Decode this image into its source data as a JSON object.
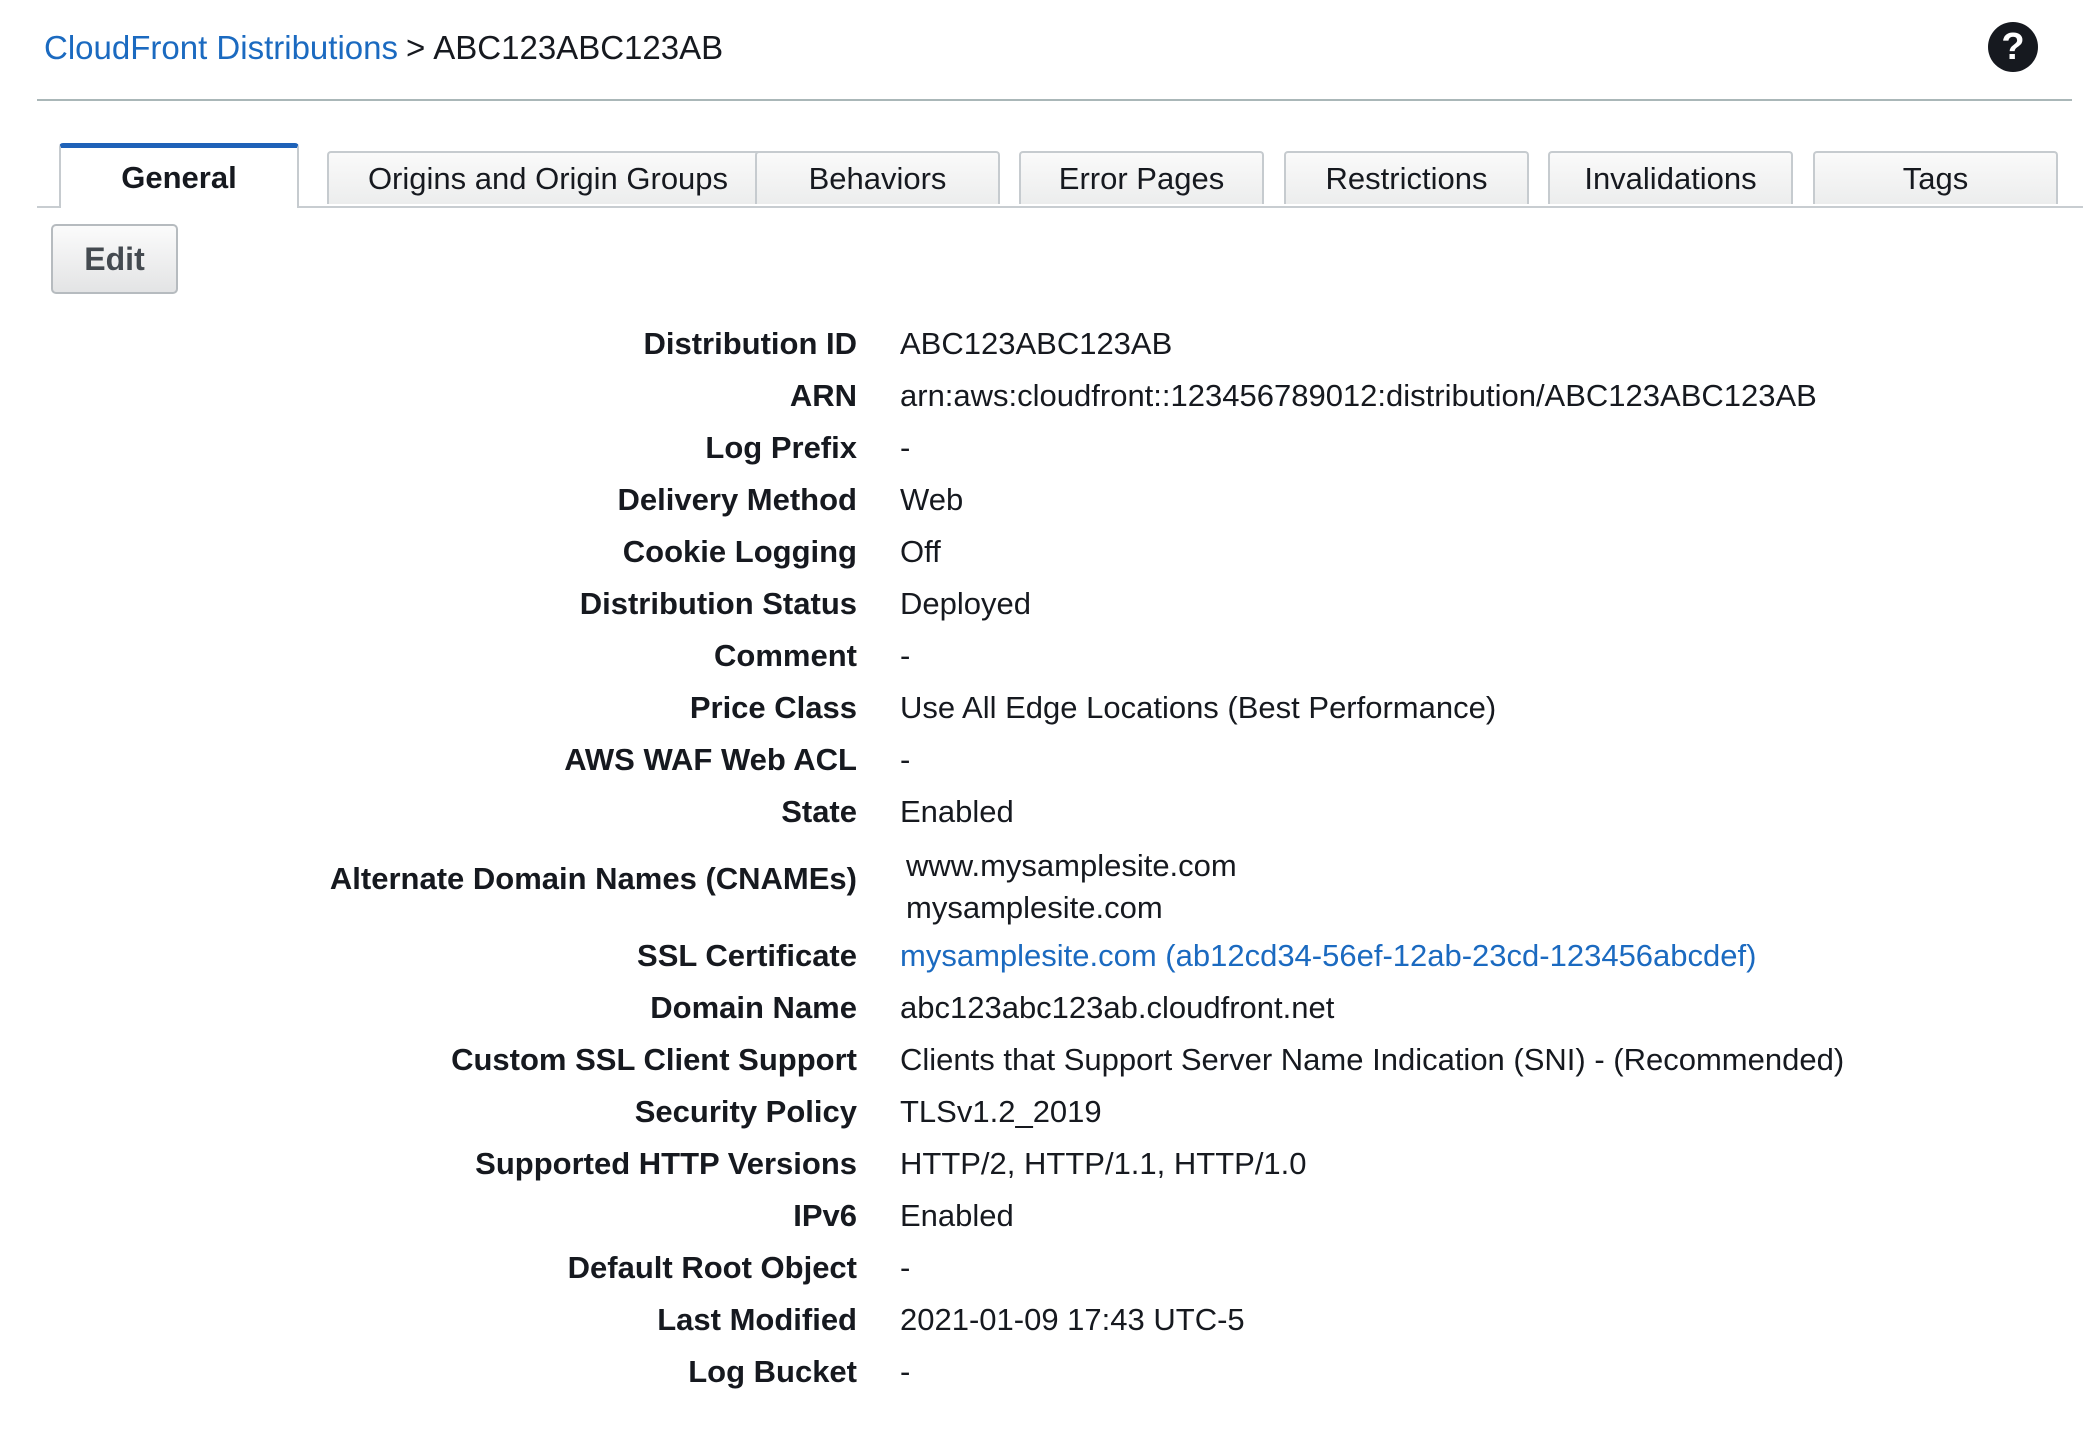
{
  "breadcrumb": {
    "link": "CloudFront Distributions",
    "separator": ">",
    "current": "ABC123ABC123AB"
  },
  "help_icon": "question-circle-icon",
  "tabs": [
    {
      "label": "General",
      "active": true
    },
    {
      "label": "Origins and Origin Groups",
      "active": false
    },
    {
      "label": "Behaviors",
      "active": false
    },
    {
      "label": "Error Pages",
      "active": false
    },
    {
      "label": "Restrictions",
      "active": false
    },
    {
      "label": "Invalidations",
      "active": false
    },
    {
      "label": "Tags",
      "active": false
    }
  ],
  "edit_button": "Edit",
  "details": {
    "distribution_id": {
      "label": "Distribution ID",
      "value": "ABC123ABC123AB"
    },
    "arn": {
      "label": "ARN",
      "value": "arn:aws:cloudfront::123456789012:distribution/ABC123ABC123AB"
    },
    "log_prefix": {
      "label": "Log Prefix",
      "value": "-"
    },
    "delivery_method": {
      "label": "Delivery Method",
      "value": "Web"
    },
    "cookie_logging": {
      "label": "Cookie Logging",
      "value": "Off"
    },
    "distribution_status": {
      "label": "Distribution Status",
      "value": "Deployed"
    },
    "comment": {
      "label": "Comment",
      "value": "-"
    },
    "price_class": {
      "label": "Price Class",
      "value": "Use All Edge Locations (Best Performance)"
    },
    "waf_acl": {
      "label": "AWS WAF Web ACL",
      "value": "-"
    },
    "state": {
      "label": "State",
      "value": "Enabled"
    },
    "cnames": {
      "label": "Alternate Domain Names (CNAMEs)",
      "values": [
        "www.mysamplesite.com",
        "mysamplesite.com"
      ]
    },
    "ssl_certificate": {
      "label": "SSL Certificate",
      "value": "mysamplesite.com (ab12cd34-56ef-12ab-23cd-123456abcdef)"
    },
    "domain_name": {
      "label": "Domain Name",
      "value": "abc123abc123ab.cloudfront.net"
    },
    "custom_ssl": {
      "label": "Custom SSL Client Support",
      "value": "Clients that Support Server Name Indication (SNI) - (Recommended)"
    },
    "security_policy": {
      "label": "Security Policy",
      "value": "TLSv1.2_2019"
    },
    "http_versions": {
      "label": "Supported HTTP Versions",
      "value": "HTTP/2, HTTP/1.1, HTTP/1.0"
    },
    "ipv6": {
      "label": "IPv6",
      "value": "Enabled"
    },
    "default_root_object": {
      "label": "Default Root Object",
      "value": "-"
    },
    "last_modified": {
      "label": "Last Modified",
      "value": "2021-01-09 17:43 UTC-5"
    },
    "log_bucket": {
      "label": "Log Bucket",
      "value": "-"
    }
  },
  "colors": {
    "link": "#1b6ac0",
    "active_tab_accent": "#1f62b8",
    "text": "#16191f"
  }
}
